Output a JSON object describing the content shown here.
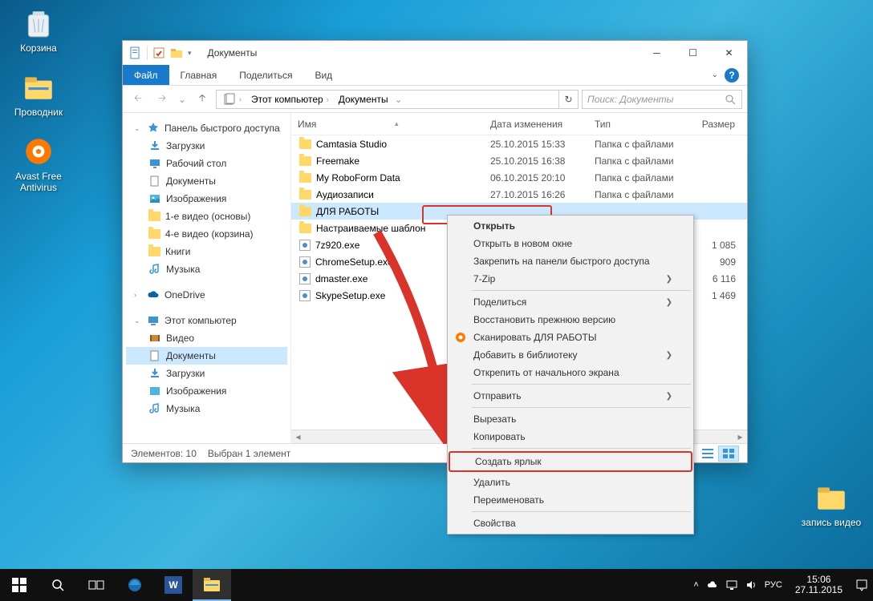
{
  "desktop": {
    "icons": [
      {
        "label": "Корзина"
      },
      {
        "label": "Проводник"
      },
      {
        "label": "Avast Free Antivirus"
      }
    ],
    "folder_icon": {
      "label": "запись видео"
    }
  },
  "window": {
    "title": "Документы",
    "tabs": {
      "file": "Файл",
      "home": "Главная",
      "share": "Поделиться",
      "view": "Вид"
    },
    "breadcrumb": [
      "Этот компьютер",
      "Документы"
    ],
    "search_placeholder": "Поиск: Документы",
    "nav": {
      "quick": {
        "header": "Панель быстрого доступа",
        "items": [
          "Загрузки",
          "Рабочий стол",
          "Документы",
          "Изображения",
          "1-е видео (основы)",
          "4-е видео (корзина)",
          "Книги",
          "Музыка"
        ]
      },
      "onedrive": "OneDrive",
      "thispc": {
        "header": "Этот компьютер",
        "items": [
          "Видео",
          "Документы",
          "Загрузки",
          "Изображения",
          "Музыка"
        ]
      }
    },
    "cols": {
      "name": "Имя",
      "date": "Дата изменения",
      "type": "Тип",
      "size": "Размер"
    },
    "rows": [
      {
        "name": "Camtasia Studio",
        "date": "25.10.2015 15:33",
        "type": "Папка с файлами",
        "size": "",
        "kind": "folder"
      },
      {
        "name": "Freemake",
        "date": "25.10.2015 16:38",
        "type": "Папка с файлами",
        "size": "",
        "kind": "folder"
      },
      {
        "name": "My RoboForm Data",
        "date": "06.10.2015 20:10",
        "type": "Папка с файлами",
        "size": "",
        "kind": "folder"
      },
      {
        "name": "Аудиозаписи",
        "date": "27.10.2015 16:26",
        "type": "Папка с файлами",
        "size": "",
        "kind": "folder"
      },
      {
        "name": "ДЛЯ РАБОТЫ",
        "date": "",
        "type": "",
        "size": "",
        "kind": "folder",
        "sel": true
      },
      {
        "name": "Настраиваемые шаблон",
        "date": "",
        "type": "",
        "size": "",
        "kind": "folder"
      },
      {
        "name": "7z920.exe",
        "date": "",
        "type": "",
        "size": "1 085",
        "kind": "exe"
      },
      {
        "name": "ChromeSetup.exe",
        "date": "",
        "type": "",
        "size": "909",
        "kind": "exe"
      },
      {
        "name": "dmaster.exe",
        "date": "",
        "type": "",
        "size": "6 116",
        "kind": "exe"
      },
      {
        "name": "SkypeSetup.exe",
        "date": "",
        "type": "",
        "size": "1 469",
        "kind": "exe"
      }
    ],
    "status": {
      "count": "Элементов: 10",
      "sel": "Выбран 1 элемент"
    }
  },
  "ctx": [
    {
      "t": "Открыть",
      "bold": true
    },
    {
      "t": "Открыть в новом окне"
    },
    {
      "t": "Закрепить на панели быстрого доступа"
    },
    {
      "t": "7-Zip",
      "sub": true
    },
    {
      "sep": true
    },
    {
      "t": "Поделиться",
      "sub": true
    },
    {
      "t": "Восстановить прежнюю версию"
    },
    {
      "t": "Сканировать ДЛЯ РАБОТЫ",
      "icon": "avast"
    },
    {
      "t": "Добавить в библиотеку",
      "sub": true
    },
    {
      "t": "Открепить от начального экрана"
    },
    {
      "sep": true
    },
    {
      "t": "Отправить",
      "sub": true
    },
    {
      "sep": true
    },
    {
      "t": "Вырезать"
    },
    {
      "t": "Копировать"
    },
    {
      "sep": true
    },
    {
      "t": "Создать ярлык",
      "hl": true
    },
    {
      "t": "Удалить"
    },
    {
      "t": "Переименовать"
    },
    {
      "sep": true
    },
    {
      "t": "Свойства"
    }
  ],
  "taskbar": {
    "lang": "РУС",
    "time": "15:06",
    "date": "27.11.2015"
  }
}
